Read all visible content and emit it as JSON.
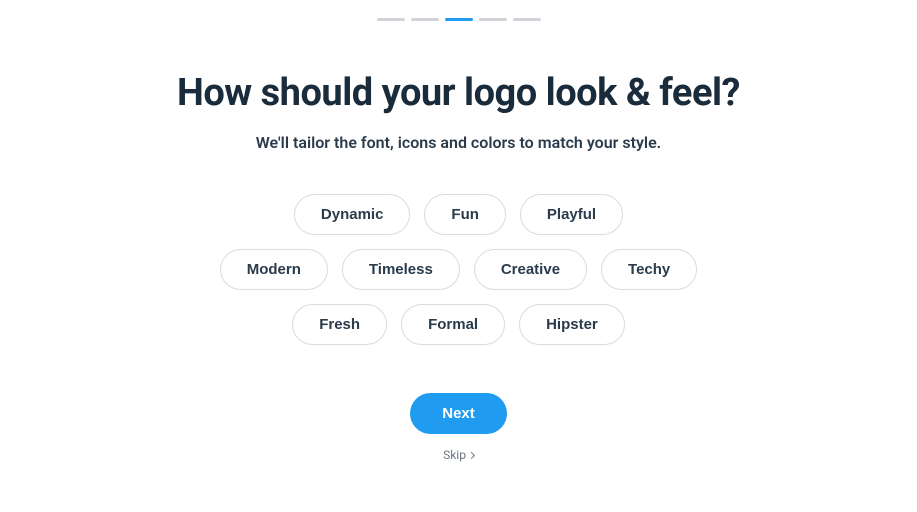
{
  "progress": {
    "total": 5,
    "current_index": 2
  },
  "heading": "How should your logo look & feel?",
  "subheading": "We'll tailor the font, icons and colors to match your style.",
  "options": {
    "row1": [
      "Dynamic",
      "Fun",
      "Playful"
    ],
    "row2": [
      "Modern",
      "Timeless",
      "Creative",
      "Techy"
    ],
    "row3": [
      "Fresh",
      "Formal",
      "Hipster"
    ]
  },
  "buttons": {
    "next": "Next",
    "skip": "Skip"
  },
  "colors": {
    "accent": "#1f9cf0",
    "text_primary": "#1a2b3c",
    "text_secondary": "#6b7580",
    "border": "#d8dce0"
  }
}
